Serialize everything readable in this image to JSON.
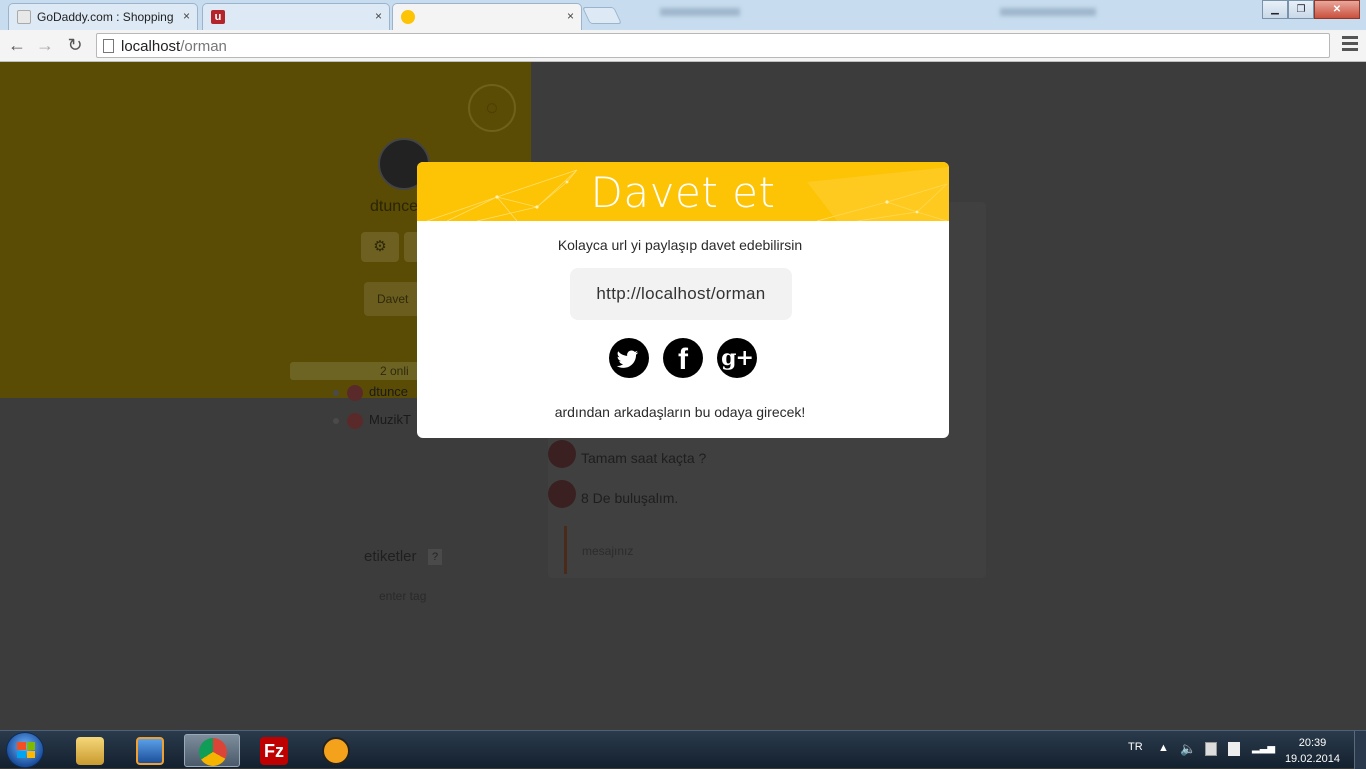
{
  "browser": {
    "tabs": [
      {
        "title": "GoDaddy.com : Shopping",
        "close": "×"
      },
      {
        "title": "",
        "close": "×"
      },
      {
        "title": "",
        "close": "×"
      }
    ],
    "url_host": "localhost",
    "url_path": "/orman",
    "window_buttons": {
      "minimize": "▁",
      "maximize": "❐",
      "close": "✕"
    }
  },
  "sidebar": {
    "username": "dtunce",
    "settings_icon": "⚙",
    "invite_button": "Davet",
    "online_label": "2 onli",
    "users": [
      {
        "name": "dtunce"
      },
      {
        "name": "MuzikT"
      }
    ],
    "tags_label": "etiketler",
    "tags_help": "?",
    "tag_placeholder": "enter tag"
  },
  "chat": {
    "messages": [
      {
        "text": "Tamam saat kaçta ?"
      },
      {
        "text": "8 De buluşalım."
      }
    ],
    "input_placeholder": "mesajınız"
  },
  "modal": {
    "title": "Davet et",
    "subtitle": "Kolayca url yi paylaşıp davet edebilirsin",
    "share_url": "http://localhost/orman",
    "social": [
      {
        "name": "twitter",
        "glyph": ""
      },
      {
        "name": "facebook",
        "glyph": "f"
      },
      {
        "name": "google-plus",
        "glyph": "g+"
      }
    ],
    "footer": "ardından arkadaşların bu odaya girecek!",
    "header_color": "#fdc305"
  },
  "taskbar": {
    "language": "TR",
    "time": "20:39",
    "date": "19.02.2014"
  }
}
